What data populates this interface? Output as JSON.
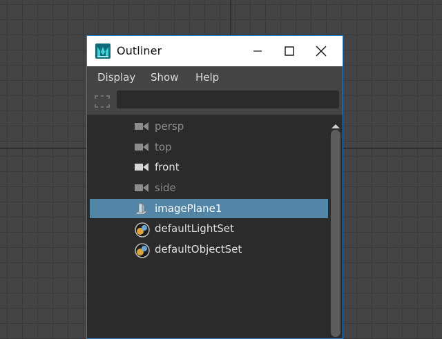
{
  "window": {
    "title": "Outliner",
    "accent_color": "#2c7cc8",
    "buttons": {
      "minimize": "minimize-icon",
      "maximize": "maximize-icon",
      "close": "close-icon"
    }
  },
  "menu": {
    "items": [
      {
        "label": "Display"
      },
      {
        "label": "Show"
      },
      {
        "label": "Help"
      }
    ]
  },
  "filter": {
    "value": "",
    "placeholder": ""
  },
  "outliner": {
    "selected_color": "#5285a6",
    "items": [
      {
        "label": "persp",
        "icon": "camera-icon",
        "state": "dimmed"
      },
      {
        "label": "top",
        "icon": "camera-icon",
        "state": "dimmed"
      },
      {
        "label": "front",
        "icon": "camera-icon",
        "state": "normal"
      },
      {
        "label": "side",
        "icon": "camera-icon",
        "state": "dimmed"
      },
      {
        "label": "imagePlane1",
        "icon": "image-plane-icon",
        "state": "selected"
      },
      {
        "label": "defaultLightSet",
        "icon": "set-icon",
        "state": "normal"
      },
      {
        "label": "defaultObjectSet",
        "icon": "set-icon",
        "state": "normal"
      }
    ]
  }
}
